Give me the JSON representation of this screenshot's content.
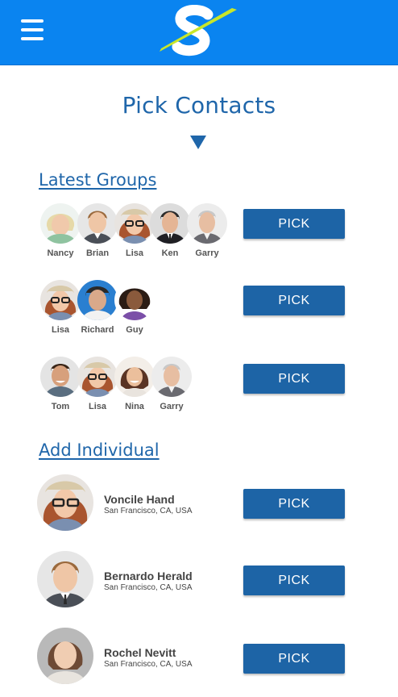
{
  "header": {
    "brand_color": "#0a84f0",
    "logo_accent": "#c8e62a",
    "menu_icon": "hamburger-menu-icon",
    "logo_icon": "s-brand-logo-icon"
  },
  "page": {
    "title": "Pick Contacts"
  },
  "latest_groups": {
    "heading": "Latest Groups",
    "groups": [
      {
        "members": [
          "Nancy",
          "Brian",
          "Lisa",
          "Ken",
          "Garry"
        ],
        "pick_label": "PICK"
      },
      {
        "members": [
          "Lisa",
          "Richard",
          "Guy"
        ],
        "pick_label": "PICK"
      },
      {
        "members": [
          "Tom",
          "Lisa",
          "Nina",
          "Garry"
        ],
        "pick_label": "PICK"
      }
    ]
  },
  "add_individual": {
    "heading": "Add Individual",
    "people": [
      {
        "name": "Voncile Hand",
        "location": "San Francisco, CA, USA",
        "pick_label": "PICK"
      },
      {
        "name": "Bernardo Herald",
        "location": "San Francisco, CA, USA",
        "pick_label": "PICK"
      },
      {
        "name": "Rochel Nevitt",
        "location": "San Francisco, CA, USA",
        "pick_label": "PICK"
      }
    ]
  },
  "colors": {
    "accent": "#1f66aa",
    "button": "#1d64a6"
  }
}
